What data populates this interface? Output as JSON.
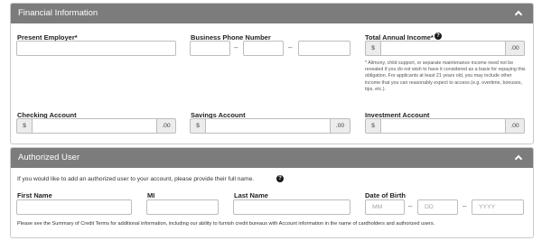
{
  "financial": {
    "title": "Financial Information",
    "present_employer": {
      "label": "Present Employer*",
      "value": ""
    },
    "business_phone": {
      "label": "Business Phone Number",
      "sep1": "–",
      "sep2": "–"
    },
    "total_income": {
      "label": "Total Annual Income*",
      "prefix": "$",
      "suffix": ".00",
      "note": "* Alimony, child support, or separate maintenance income need not be revealed if you do not wish to have it considered as a basis for repaying this obligation. For applicants at least 21 years old, you may include other income that you can reasonably expect to access (e.g. overtime, bonuses, tips, etc.)."
    },
    "checking": {
      "label": "Checking Account",
      "prefix": "$",
      "suffix": ".00"
    },
    "savings": {
      "label": "Savings Account",
      "prefix": "$",
      "suffix": ".00"
    },
    "investment": {
      "label": "Investment Account",
      "prefix": "$",
      "suffix": ".00"
    }
  },
  "authorized": {
    "title": "Authorized User",
    "intro": "If you would like to add an authorized user to your account, please provide their full name.",
    "first_name": {
      "label": "First Name"
    },
    "mi": {
      "label": "MI"
    },
    "last_name": {
      "label": "Last Name"
    },
    "dob": {
      "label": "Date of Birth",
      "mm": "MM",
      "dd": "DD",
      "yyyy": "YYYY",
      "sep": "–"
    },
    "footer": "Please see the Summary of Credit Terms for additional information, including our ability to furnish credit bureaus with Account information in the name of cardholders and authorized users."
  },
  "icons": {
    "help": "?",
    "collapse": "chevron-up-icon"
  },
  "colors": {
    "header_bg": "#7c7c7c",
    "border": "#c9c9c9",
    "adornment_bg": "#ececec"
  }
}
